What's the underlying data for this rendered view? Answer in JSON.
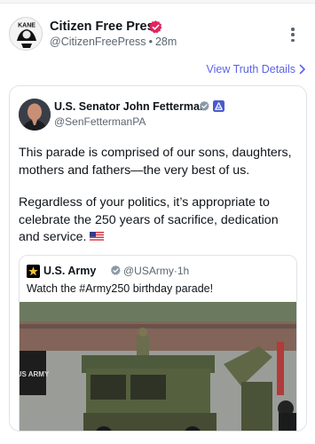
{
  "post": {
    "author_name": "Citizen Free Press",
    "handle": "@CitizenFreePress",
    "time": "28m",
    "separator": "•",
    "avatar_text": "KANE",
    "details_link": "View Truth Details"
  },
  "quoted": {
    "author_name": "U.S. Senator John Fetterman",
    "handle": "@SenFettermanPA",
    "paragraph_1": "This parade is comprised of our sons, daughters, mothers and fathers—the very best of us.",
    "paragraph_2": "Regardless of your politics, it’s appropriate to celebrate the 250 years of sacrifice, dedication and service.",
    "nested": {
      "author_name": "U.S. Army",
      "handle": "@USArmy",
      "time": "1h",
      "separator": "·",
      "text": "Watch the #Army250 birthday parade!",
      "banner_text": "US ARMY"
    }
  },
  "colors": {
    "link": "#5b63e6",
    "verified_badge": "#e0245e",
    "x_verified_badge": "#1d9bf0",
    "text_secondary": "#5b6570"
  },
  "icons": {
    "verified": "verified-badge-icon",
    "menu": "more-vertical-icon",
    "chevron": "chevron-right-icon",
    "flag": "us-flag-icon"
  }
}
